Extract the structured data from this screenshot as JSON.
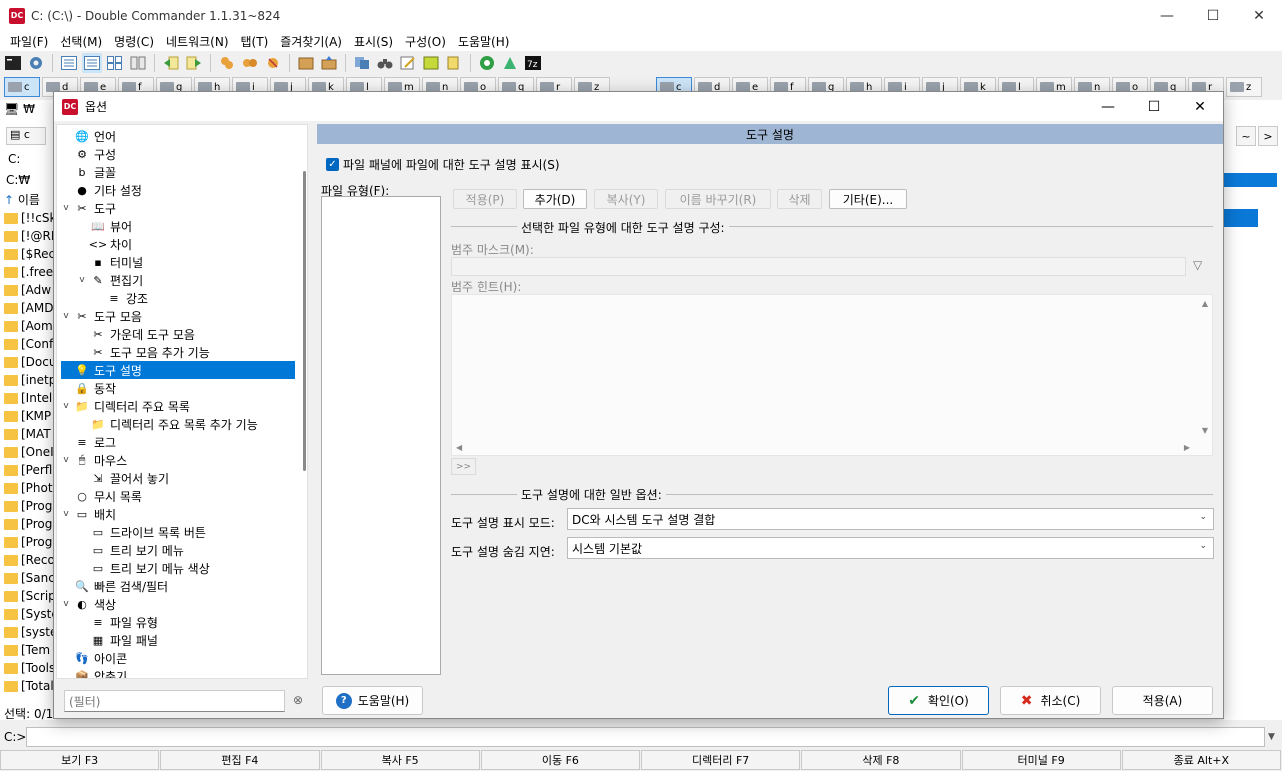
{
  "window": {
    "title": "C: (C:\\) - Double Commander 1.1.31~824",
    "logo": "DC",
    "minimize": "—",
    "maximize": "☐",
    "close": "✕"
  },
  "menubar": {
    "items": [
      {
        "label": "파일(F)"
      },
      {
        "label": "선택(M)"
      },
      {
        "label": "명령(C)"
      },
      {
        "label": "네트워크(N)"
      },
      {
        "label": "탭(T)"
      },
      {
        "label": "즐겨찾기(A)"
      },
      {
        "label": "표시(S)"
      },
      {
        "label": "구성(O)"
      },
      {
        "label": "도움말(H)"
      }
    ]
  },
  "drivebar": {
    "left_drives": [
      {
        "letter": "c",
        "active": true
      },
      {
        "letter": "d"
      },
      {
        "letter": "e"
      },
      {
        "letter": "f"
      },
      {
        "letter": "g"
      },
      {
        "letter": "h"
      },
      {
        "letter": "i"
      },
      {
        "letter": "j"
      },
      {
        "letter": "k"
      },
      {
        "letter": "l"
      },
      {
        "letter": "m"
      },
      {
        "letter": "n"
      },
      {
        "letter": "o"
      },
      {
        "letter": "q"
      },
      {
        "letter": "r"
      },
      {
        "letter": "z"
      }
    ],
    "right_drives": [
      {
        "letter": "c",
        "active": true
      },
      {
        "letter": "d"
      },
      {
        "letter": "e"
      },
      {
        "letter": "f"
      },
      {
        "letter": "g"
      },
      {
        "letter": "h"
      },
      {
        "letter": "i"
      },
      {
        "letter": "j"
      },
      {
        "letter": "k"
      },
      {
        "letter": "l"
      },
      {
        "letter": "m"
      },
      {
        "letter": "n"
      },
      {
        "letter": "o"
      },
      {
        "letter": "q"
      },
      {
        "letter": "r"
      },
      {
        "letter": "z"
      }
    ]
  },
  "left_panel": {
    "net_label": "₩",
    "path_drive": "c",
    "path": "C:",
    "path_full": "C:₩",
    "header": "이름",
    "rows": [
      "[!!cSk",
      "[!@RI",
      "[$Rec",
      "[.free",
      "[Adw",
      "[AMD",
      "[Aom",
      "[Conf",
      "[Docu",
      "[inetp",
      "[Intel]",
      "[KMP",
      "[MAT",
      "[OneI",
      "[Perfl",
      "[Phot",
      "[Prog",
      "[Prog",
      "[Prog",
      "[Reco",
      "[Sanc",
      "[Scrip",
      "[Syste",
      "[syste",
      "[Tem",
      "[Tools",
      "[Total"
    ],
    "status": "선택: 0/1"
  },
  "right_panel": {
    "nav_back": "~",
    "nav_fwd": ">"
  },
  "cmdline": {
    "label": "C:>",
    "drop": "▼"
  },
  "fkeys": [
    {
      "label": "보기 F3"
    },
    {
      "label": "편집 F4"
    },
    {
      "label": "복사 F5"
    },
    {
      "label": "이동 F6"
    },
    {
      "label": "디렉터리 F7"
    },
    {
      "label": "삭제 F8"
    },
    {
      "label": "터미널 F9"
    },
    {
      "label": "종료 Alt+X"
    }
  ],
  "dialog": {
    "title": "옵션",
    "logo": "DC",
    "minimize": "—",
    "maximize": "☐",
    "close": "✕",
    "tree": [
      {
        "label": "언어",
        "depth": 0,
        "icon": "🌐",
        "chev": ""
      },
      {
        "label": "구성",
        "depth": 0,
        "icon": "⚙",
        "chev": ""
      },
      {
        "label": "글꼴",
        "depth": 0,
        "icon": "b",
        "chev": ""
      },
      {
        "label": "기타 설정",
        "depth": 0,
        "icon": "●",
        "chev": ""
      },
      {
        "label": "도구",
        "depth": 0,
        "icon": "✂",
        "chev": "v"
      },
      {
        "label": "뷰어",
        "depth": 1,
        "icon": "📖",
        "chev": ""
      },
      {
        "label": "차이",
        "depth": 1,
        "icon": "<>",
        "chev": ""
      },
      {
        "label": "터미널",
        "depth": 1,
        "icon": "▪",
        "chev": ""
      },
      {
        "label": "편집기",
        "depth": 1,
        "icon": "✎",
        "chev": "v"
      },
      {
        "label": "강조",
        "depth": 2,
        "icon": "≡",
        "chev": ""
      },
      {
        "label": "도구 모음",
        "depth": 0,
        "icon": "✂",
        "chev": "v"
      },
      {
        "label": "가운데 도구 모음",
        "depth": 1,
        "icon": "✂",
        "chev": ""
      },
      {
        "label": "도구 모음 추가 기능",
        "depth": 1,
        "icon": "✂",
        "chev": ""
      },
      {
        "label": "도구 설명",
        "depth": 0,
        "icon": "💡",
        "chev": "",
        "selected": true
      },
      {
        "label": "동작",
        "depth": 0,
        "icon": "🔒",
        "chev": ""
      },
      {
        "label": "디렉터리 주요 목록",
        "depth": 0,
        "icon": "📁",
        "chev": "v"
      },
      {
        "label": "디렉터리 주요 목록 추가 기능",
        "depth": 1,
        "icon": "📁",
        "chev": ""
      },
      {
        "label": "로그",
        "depth": 0,
        "icon": "≡",
        "chev": ""
      },
      {
        "label": "마우스",
        "depth": 0,
        "icon": "🖱",
        "chev": "v"
      },
      {
        "label": "끌어서 놓기",
        "depth": 1,
        "icon": "⇲",
        "chev": ""
      },
      {
        "label": "무시 목록",
        "depth": 0,
        "icon": "○",
        "chev": ""
      },
      {
        "label": "배치",
        "depth": 0,
        "icon": "▭",
        "chev": "v"
      },
      {
        "label": "드라이브 목록 버튼",
        "depth": 1,
        "icon": "▭",
        "chev": ""
      },
      {
        "label": "트리 보기 메뉴",
        "depth": 1,
        "icon": "▭",
        "chev": ""
      },
      {
        "label": "트리 보기 메뉴 색상",
        "depth": 1,
        "icon": "▭",
        "chev": ""
      },
      {
        "label": "빠른 검색/필터",
        "depth": 0,
        "icon": "🔍",
        "chev": ""
      },
      {
        "label": "색상",
        "depth": 0,
        "icon": "◐",
        "chev": "v"
      },
      {
        "label": "파일 유형",
        "depth": 1,
        "icon": "≡",
        "chev": ""
      },
      {
        "label": "파일 패널",
        "depth": 1,
        "icon": "▦",
        "chev": ""
      },
      {
        "label": "아이콘",
        "depth": 0,
        "icon": "👣",
        "chev": ""
      },
      {
        "label": "압축기",
        "depth": 0,
        "icon": "📦",
        "chev": ""
      }
    ],
    "filter_placeholder": "(필터)",
    "filter_clear": "⊗",
    "help_label": "도움말(H)",
    "help_icon": "?",
    "ok_label": "확인(O)",
    "ok_icon": "✔",
    "cancel_label": "취소(C)",
    "cancel_icon": "✖",
    "apply_label": "적용(A)",
    "page": {
      "header": "도구 설명",
      "show_tooltips_label": "파일 패널에 파일에 대한 도구 설명 표시(S)",
      "show_tooltips_checked": true,
      "check_glyph": "✓",
      "file_types_label": "파일 유형(F):",
      "buttons": {
        "apply": "적용(P)",
        "add": "추가(D)",
        "copy": "복사(Y)",
        "rename": "이름 바꾸기(R)",
        "delete": "삭제",
        "other": "기타(E)..."
      },
      "group1_title": "선택한 파일 유형에 대한 도구 설명 구성:",
      "category_mask_label": "범주 마스크(M):",
      "mask_filter_icon": "▽",
      "category_hint_label": "범주 힌트(H):",
      "scroll_up": "▲",
      "scroll_down": "▼",
      "scroll_left": "◀",
      "scroll_right": "▶",
      "more_btn": ">>",
      "group2_title": "도구 설명에 대한 일반 옵션:",
      "display_mode_label": "도구 설명 표시 모드:",
      "display_mode_value": "DC와 시스템 도구 설명 결합",
      "hide_delay_label": "도구 설명 숨김 지연:",
      "hide_delay_value": "시스템 기본값",
      "combo_arrow": "⌄"
    }
  }
}
